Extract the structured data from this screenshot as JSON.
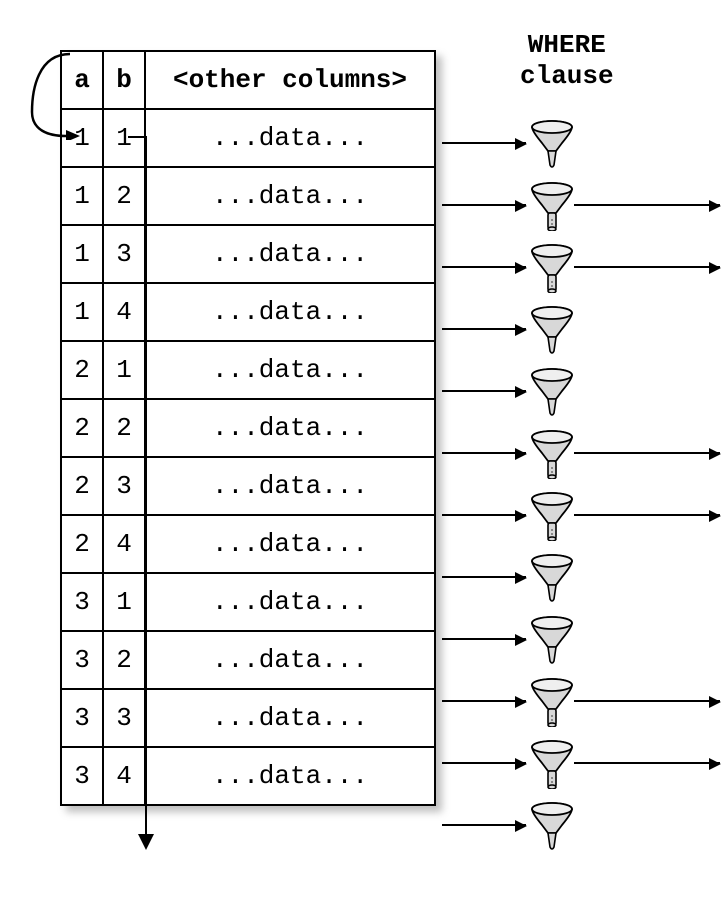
{
  "labels": {
    "where": "WHERE",
    "clause": "clause"
  },
  "headers": {
    "a": "a",
    "b": "b",
    "other": "<other columns>"
  },
  "rows": [
    {
      "a": "1",
      "b": "1",
      "data": "...data...",
      "pass": false
    },
    {
      "a": "1",
      "b": "2",
      "data": "...data...",
      "pass": true
    },
    {
      "a": "1",
      "b": "3",
      "data": "...data...",
      "pass": true
    },
    {
      "a": "1",
      "b": "4",
      "data": "...data...",
      "pass": false
    },
    {
      "a": "2",
      "b": "1",
      "data": "...data...",
      "pass": false
    },
    {
      "a": "2",
      "b": "2",
      "data": "...data...",
      "pass": true
    },
    {
      "a": "2",
      "b": "3",
      "data": "...data...",
      "pass": true
    },
    {
      "a": "2",
      "b": "4",
      "data": "...data...",
      "pass": false
    },
    {
      "a": "3",
      "b": "1",
      "data": "...data...",
      "pass": false
    },
    {
      "a": "3",
      "b": "2",
      "data": "...data...",
      "pass": true
    },
    {
      "a": "3",
      "b": "3",
      "data": "...data...",
      "pass": true
    },
    {
      "a": "3",
      "b": "4",
      "data": "...data...",
      "pass": false
    }
  ],
  "chart_data": {
    "type": "table",
    "columns": [
      "a",
      "b",
      "<other columns>"
    ],
    "rows": [
      [
        1,
        1,
        "...data..."
      ],
      [
        1,
        2,
        "...data..."
      ],
      [
        1,
        3,
        "...data..."
      ],
      [
        1,
        4,
        "...data..."
      ],
      [
        2,
        1,
        "...data..."
      ],
      [
        2,
        2,
        "...data..."
      ],
      [
        2,
        3,
        "...data..."
      ],
      [
        2,
        4,
        "...data..."
      ],
      [
        3,
        1,
        "...data..."
      ],
      [
        3,
        2,
        "...data..."
      ],
      [
        3,
        3,
        "...data..."
      ],
      [
        3,
        4,
        "...data..."
      ]
    ],
    "filter": "WHERE clause",
    "passes_filter": [
      false,
      true,
      true,
      false,
      false,
      true,
      true,
      false,
      false,
      true,
      true,
      false
    ]
  }
}
